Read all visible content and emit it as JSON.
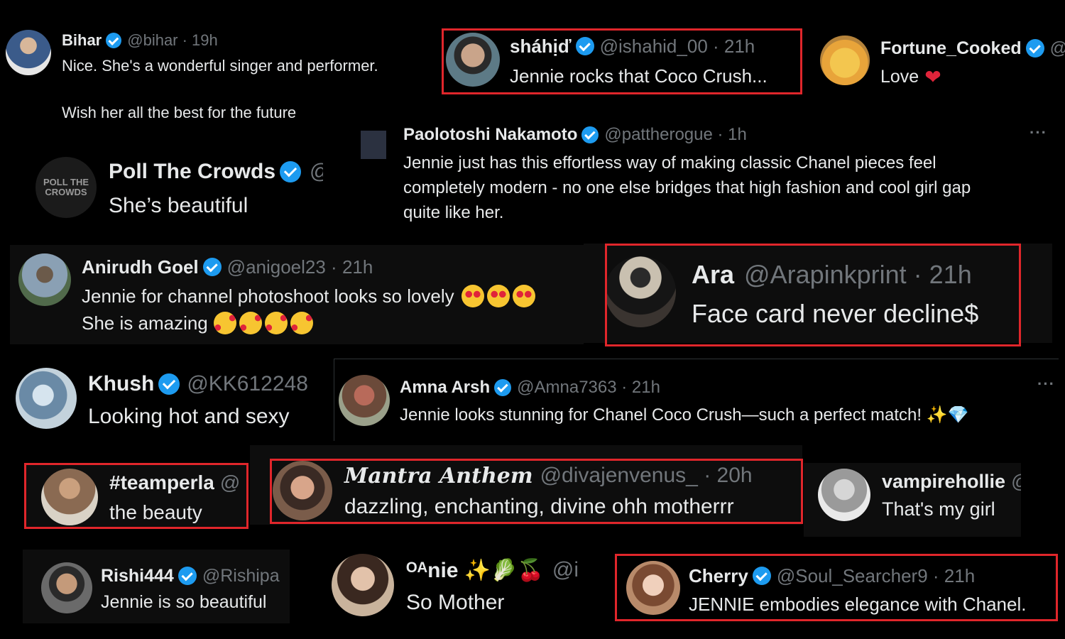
{
  "replies": [
    {
      "id": "bihar",
      "name": "Bihar",
      "handle": "@bihar · 19h",
      "text": "Nice. She's a wonderful singer and performer.",
      "text2": "Wish her all the best for the future"
    },
    {
      "id": "shahid",
      "name": "sháhịď",
      "handle": "@ishahid_00 · 21h",
      "text": "Jennie rocks that Coco Crush..."
    },
    {
      "id": "fortune",
      "name": "Fortune_Cooked",
      "handle": "@",
      "text": "Love"
    },
    {
      "id": "paolo",
      "name": "Paolotoshi Nakamoto",
      "handle": "@pattherogue · 1h",
      "text": "Jennie just has this effortless way of making classic Chanel pieces feel",
      "text2": "completely modern - no one else bridges that high fashion and cool girl gap",
      "text3": "quite like her."
    },
    {
      "id": "poll",
      "name": "Poll The Crowds",
      "handle": "@",
      "text": "She’s beautiful",
      "avatar_text": "POLL THE CROWDS"
    },
    {
      "id": "anirudh",
      "name": "Anirudh Goel",
      "handle": "@anigoel23 · 21h",
      "text": "Jennie for channel photoshoot looks so lovely",
      "text2": "She is amazing"
    },
    {
      "id": "ara",
      "name": "Ara",
      "handle": "@Arapinkprint · 21h",
      "text": "Face card never decline$"
    },
    {
      "id": "khush",
      "name": "Khush",
      "handle": "@KK612248",
      "text": "Looking hot and sexy"
    },
    {
      "id": "amna",
      "name": "Amna Arsh",
      "handle": "@Amna7363 · 21h",
      "text": "Jennie looks stunning for Chanel Coco Crush—such a perfect match! ✨💎"
    },
    {
      "id": "teamperla",
      "name": "#teamperla",
      "handle": "@",
      "text": "the beauty"
    },
    {
      "id": "mantra",
      "name": "𝑴𝒂𝒏𝒕𝒓𝒂 𝑨𝒏𝒕𝒉𝒆𝒎",
      "handle": "@divajenvenus_ · 20h",
      "text": "dazzling, enchanting, divine ohh motherrr"
    },
    {
      "id": "vampire",
      "name": "vampirehollie",
      "handle": "@",
      "text": "That's my girl"
    },
    {
      "id": "rishi",
      "name": "Rishi444",
      "handle": "@Rishipa",
      "text": "Jennie is so beautiful"
    },
    {
      "id": "anie",
      "name": "ᴼᴬnie ✨🥬🍒",
      "handle": "@i",
      "text": "So Mother"
    },
    {
      "id": "cherry",
      "name": "Cherry",
      "handle": "@Soul_Searcher9 · 21h",
      "text": "JENNIE embodies elegance with Chanel."
    }
  ],
  "more_icon": "···",
  "colors": {
    "background": "#000000",
    "verified": "#1d9bf0",
    "handle": "#71767b",
    "highlight_border": "#e0262b",
    "heart": "#f91880"
  }
}
